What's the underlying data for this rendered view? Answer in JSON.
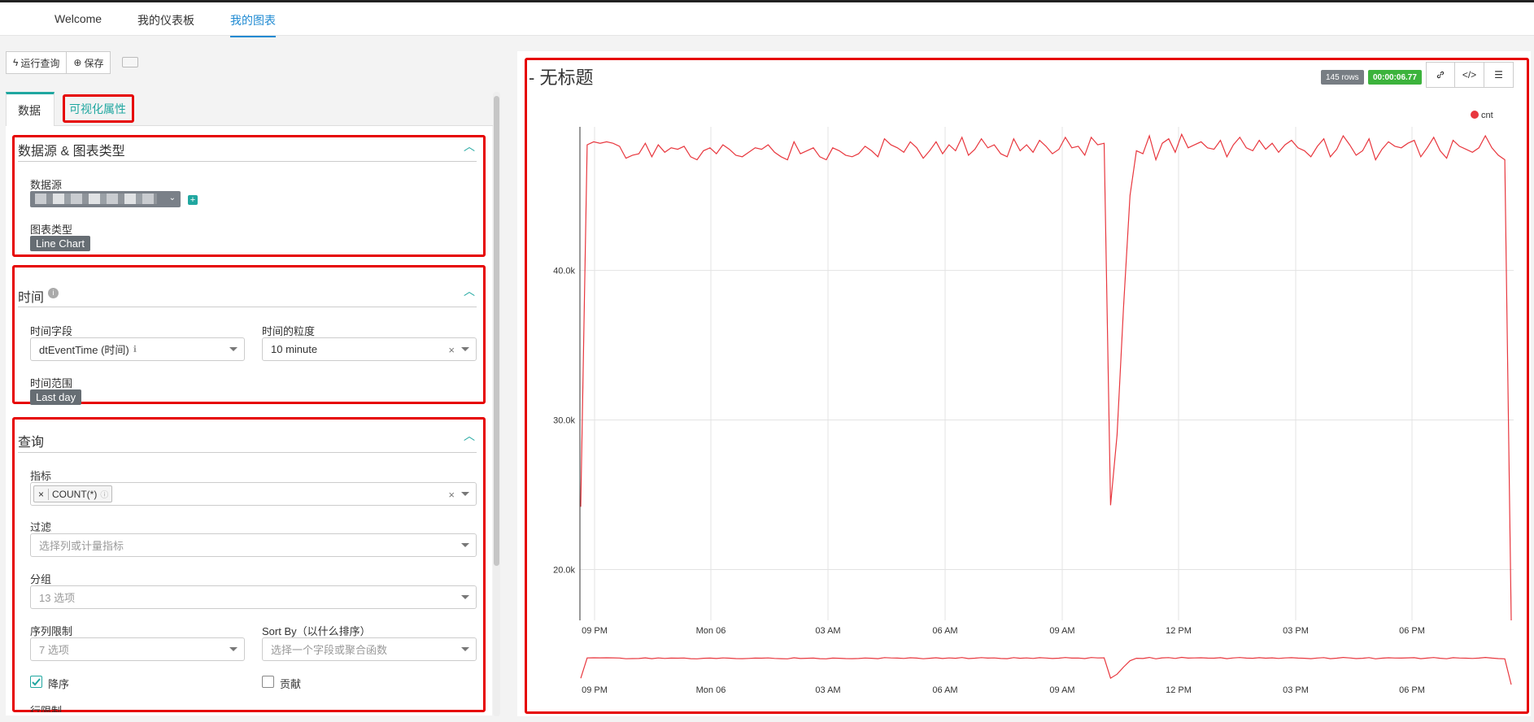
{
  "nav": {
    "items": [
      "Welcome",
      "我的仪表板",
      "我的图表"
    ],
    "active_index": 2
  },
  "toolbar": {
    "run_label": "运行查询",
    "save_label": "保存"
  },
  "tabs": {
    "data": "数据",
    "visual": "可视化属性"
  },
  "datasource_section": {
    "title": "数据源 & 图表类型",
    "source_label": "数据源",
    "chart_type_label": "图表类型",
    "chart_type_value": "Line Chart"
  },
  "time_section": {
    "title": "时间",
    "time_field_label": "时间字段",
    "time_field_value": "dtEventTime (时间)",
    "grain_label": "时间的粒度",
    "grain_value": "10 minute",
    "range_label": "时间范围",
    "range_value": "Last day"
  },
  "query_section": {
    "title": "查询",
    "metrics_label": "指标",
    "metric_tag": "COUNT(*)",
    "filter_label": "过滤",
    "filter_placeholder": "选择列或计量指标",
    "groupby_label": "分组",
    "groupby_placeholder": "13 选项",
    "series_limit_label": "序列限制",
    "series_limit_placeholder": "7 选项",
    "sortby_label": "Sort By（以什么排序）",
    "sortby_placeholder": "选择一个字段或聚合函数",
    "descending_label": "降序",
    "descending_checked": true,
    "contribution_label": "贡献",
    "contribution_checked": false,
    "row_limit_label": "行限制"
  },
  "chart_panel": {
    "title": "- 无标题",
    "rows_badge": "145 rows",
    "timer_badge": "00:00:06.77",
    "link_icon": "link-icon",
    "embed_icon": "code-icon",
    "menu_icon": "hamburger-menu-icon"
  },
  "colors": {
    "accent_teal": "#20a7a0",
    "nav_active": "#1f8ad2",
    "series_red": "#e8373e",
    "highlight_red": "#e60000",
    "timer_green": "#3cb33c"
  },
  "chart_data": {
    "type": "line",
    "legend": [
      "cnt"
    ],
    "legend_position": "top-right",
    "x_tick_labels": [
      "09 PM",
      "Mon 06",
      "03 AM",
      "06 AM",
      "09 AM",
      "12 PM",
      "03 PM",
      "06 PM"
    ],
    "y_tick_labels": [
      "20.0k",
      "30.0k",
      "40.0k"
    ],
    "ylim": [
      16600,
      49600
    ],
    "grid": true,
    "brush_x_tick_labels": [
      "09 PM",
      "Mon 06",
      "03 AM",
      "06 AM",
      "09 AM",
      "12 PM",
      "03 PM",
      "06 PM"
    ],
    "series": [
      {
        "name": "cnt",
        "values": [
          24200,
          48400,
          48600,
          48500,
          48600,
          48500,
          48300,
          47500,
          47700,
          47800,
          48500,
          47600,
          48400,
          47900,
          48200,
          48100,
          48300,
          47600,
          47400,
          48000,
          48200,
          47800,
          48400,
          48100,
          47700,
          47600,
          47900,
          48200,
          48100,
          48400,
          47900,
          47600,
          47400,
          48600,
          47800,
          48000,
          48200,
          47600,
          47400,
          48200,
          48000,
          47700,
          47600,
          47800,
          48300,
          48000,
          47600,
          48800,
          48400,
          48200,
          47900,
          48600,
          48200,
          47500,
          48000,
          48600,
          47800,
          48400,
          48000,
          48900,
          47700,
          48100,
          48800,
          48200,
          48400,
          47800,
          47600,
          48800,
          48000,
          48400,
          47900,
          48700,
          48300,
          47800,
          48100,
          48900,
          48200,
          48300,
          47700,
          48900,
          48400,
          48500,
          24300,
          29000,
          37500,
          45000,
          48000,
          47800,
          49000,
          47400,
          48500,
          48800,
          47900,
          49100,
          48200,
          48400,
          48600,
          48200,
          48100,
          48700,
          47600,
          48400,
          48900,
          48200,
          48000,
          48700,
          48100,
          48500,
          47900,
          48400,
          48700,
          48200,
          48000,
          47600,
          48300,
          48800,
          47600,
          48100,
          49000,
          48400,
          47700,
          48000,
          48800,
          47400,
          48100,
          48600,
          48300,
          48200,
          48500,
          48700,
          47600,
          48200,
          48900,
          48000,
          47500,
          48700,
          48300,
          48100,
          47900,
          48200,
          49000,
          48200,
          47700,
          47400,
          16600
        ]
      }
    ]
  }
}
